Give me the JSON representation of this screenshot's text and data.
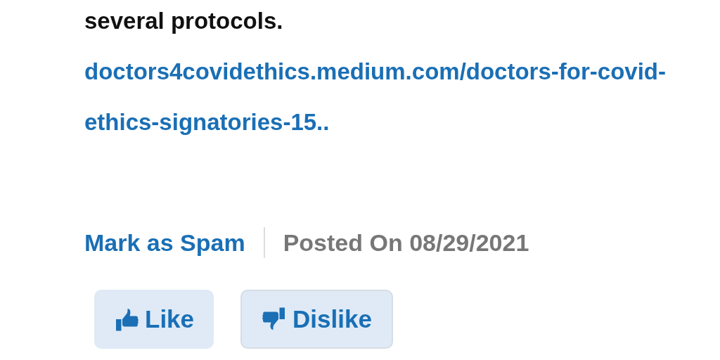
{
  "comment": {
    "text_end": "several protocols.",
    "link": "doctors4covidethics.medium.com/doctors-for-covid-ethics-signatories-15.."
  },
  "actions": {
    "spam_link": "Mark as Spam",
    "posted": "Posted On 08/29/2021"
  },
  "reactions": [
    {
      "kind": "like",
      "label": "Like"
    },
    {
      "kind": "dislike",
      "label": "Dislike"
    }
  ]
}
